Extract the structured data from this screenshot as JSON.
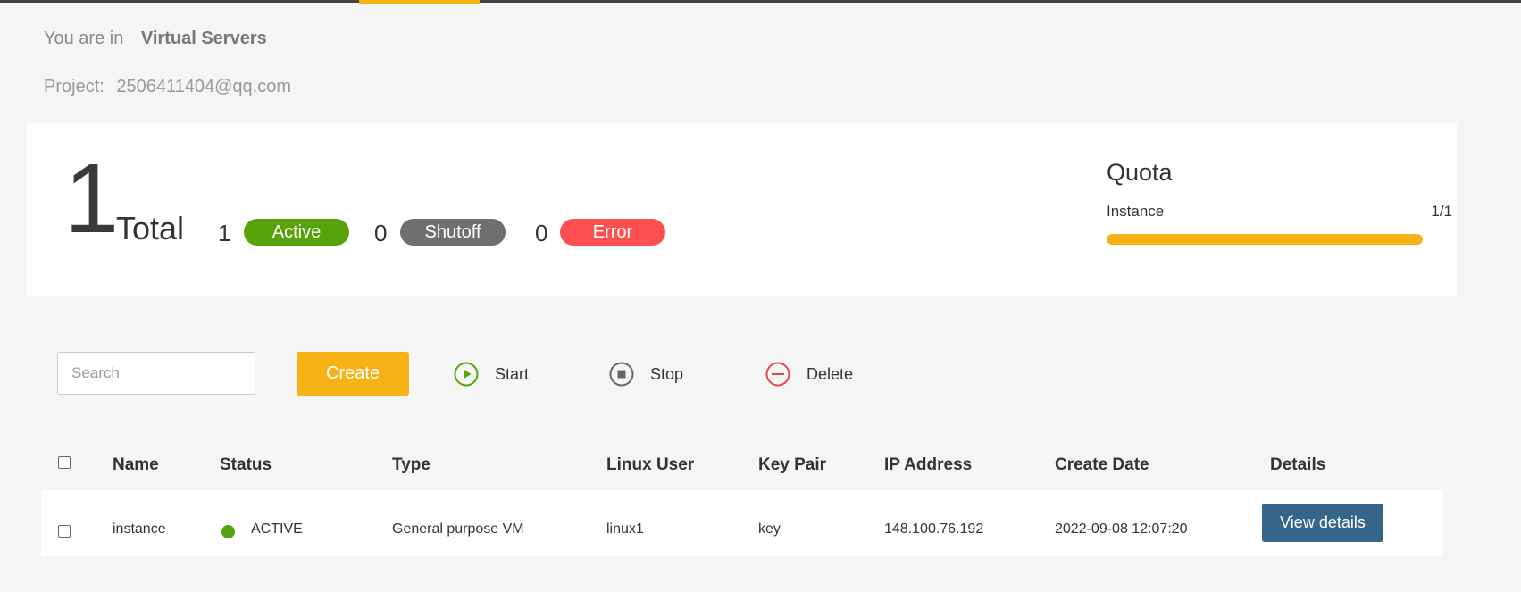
{
  "breadcrumb": {
    "prefix": "You are in",
    "current": "Virtual Servers"
  },
  "project": {
    "label": "Project:",
    "value": "2506411404@qq.com"
  },
  "summary": {
    "total_count": "1",
    "total_label": "Total",
    "active": {
      "count": "1",
      "label": "Active",
      "color": "#56a30c"
    },
    "shutoff": {
      "count": "0",
      "label": "Shutoff",
      "color": "#6f6f6f"
    },
    "error": {
      "count": "0",
      "label": "Error",
      "color": "#fc5050"
    }
  },
  "quota": {
    "title": "Quota",
    "label": "Instance",
    "value": "1/1",
    "used_fraction": 1.0,
    "color": "#f7b316"
  },
  "toolbar": {
    "search_placeholder": "Search",
    "create_label": "Create",
    "start_label": "Start",
    "start_icon": "play-circle-icon",
    "stop_label": "Stop",
    "stop_icon": "stop-circle-icon",
    "delete_label": "Delete",
    "delete_icon": "minus-circle-icon"
  },
  "table": {
    "headers": [
      "Name",
      "Status",
      "Type",
      "Linux User",
      "Key Pair",
      "IP Address",
      "Create Date",
      "Details"
    ],
    "rows": [
      {
        "name": "instance",
        "status": "ACTIVE",
        "type": "General purpose VM",
        "linux_user": "linux1",
        "key_pair": "key",
        "ip_address": "148.100.76.192",
        "create_date": "2022-09-08 12:07:20",
        "details_label": "View details"
      }
    ]
  },
  "colors": {
    "accent": "#f7b316",
    "primary_button": "#356588",
    "active_green": "#56a30c"
  }
}
